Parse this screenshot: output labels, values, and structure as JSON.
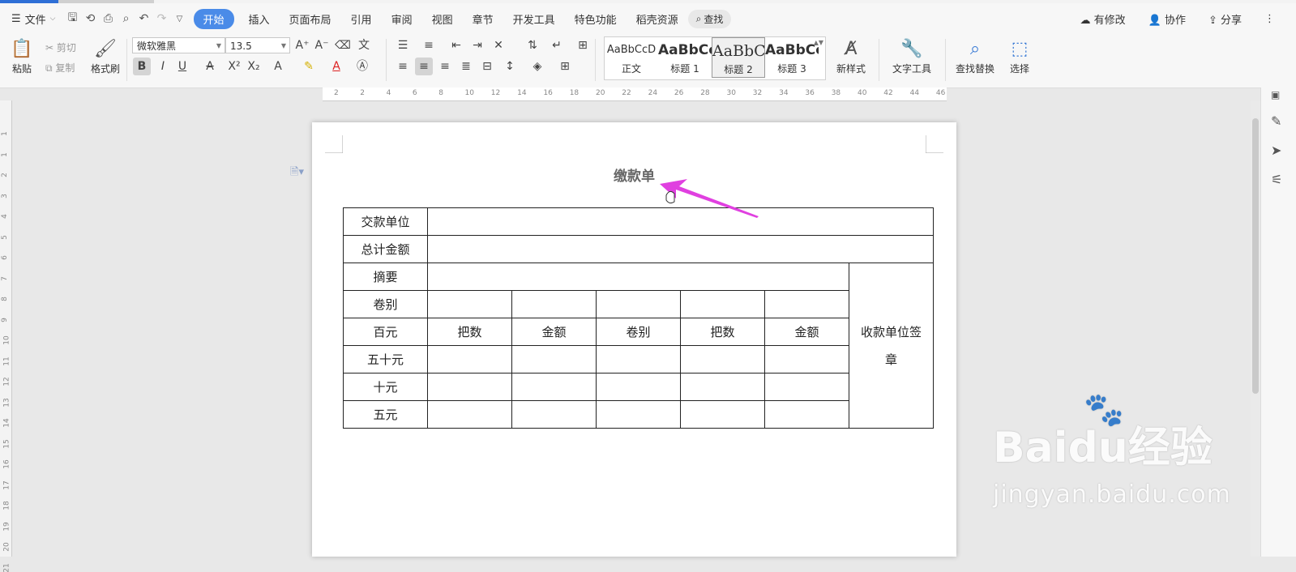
{
  "menubar": {
    "file": "文件",
    "tabs": [
      "开始",
      "插入",
      "页面布局",
      "引用",
      "审阅",
      "视图",
      "章节",
      "开发工具",
      "特色功能",
      "稻壳资源"
    ],
    "active_tab": "开始",
    "search": "查找",
    "right": [
      "有修改",
      "协作",
      "分享"
    ]
  },
  "ribbon": {
    "paste": "粘贴",
    "cut": "剪切",
    "copy": "复制",
    "format_painter": "格式刷",
    "font_name": "微软雅黑",
    "font_size": "13.5",
    "styles": [
      {
        "preview": "AaBbCcD",
        "name": "正文"
      },
      {
        "preview": "AaBbCc",
        "name": "标题 1"
      },
      {
        "preview": "AaBbC",
        "name": "标题 2"
      },
      {
        "preview": "AaBbCc",
        "name": "标题 3"
      }
    ],
    "new_style": "新样式",
    "text_tools": "文字工具",
    "find_replace": "查找替换",
    "select": "选择"
  },
  "ruler": {
    "h_ticks": [
      "2",
      "2",
      "4",
      "6",
      "8",
      "10",
      "12",
      "14",
      "16",
      "18",
      "20",
      "22",
      "24",
      "26",
      "28",
      "30",
      "32",
      "34",
      "36",
      "38",
      "40",
      "42",
      "44",
      "46"
    ],
    "v_ticks": [
      "1",
      "1",
      "2",
      "3",
      "4",
      "5",
      "6",
      "7",
      "8",
      "9",
      "10",
      "11",
      "12",
      "13",
      "14",
      "15",
      "16",
      "17",
      "18",
      "19",
      "20",
      "21"
    ]
  },
  "document": {
    "title": "缴款单",
    "rows": {
      "payer": "交款单位",
      "total": "总计金额",
      "summary": "摘要",
      "roll": "卷别",
      "hundred": "百元",
      "fifty": "五十元",
      "ten": "十元",
      "five": "五元"
    },
    "subheaders": [
      "把数",
      "金额",
      "卷别",
      "把数",
      "金额"
    ],
    "stamp": "收款单位签章"
  },
  "watermark": {
    "brand": "Bai",
    "brand_cn": "经验",
    "url": "jingyan.baidu.com"
  },
  "colors": {
    "accent": "#4a8be8",
    "arrow": "#e040e0"
  }
}
